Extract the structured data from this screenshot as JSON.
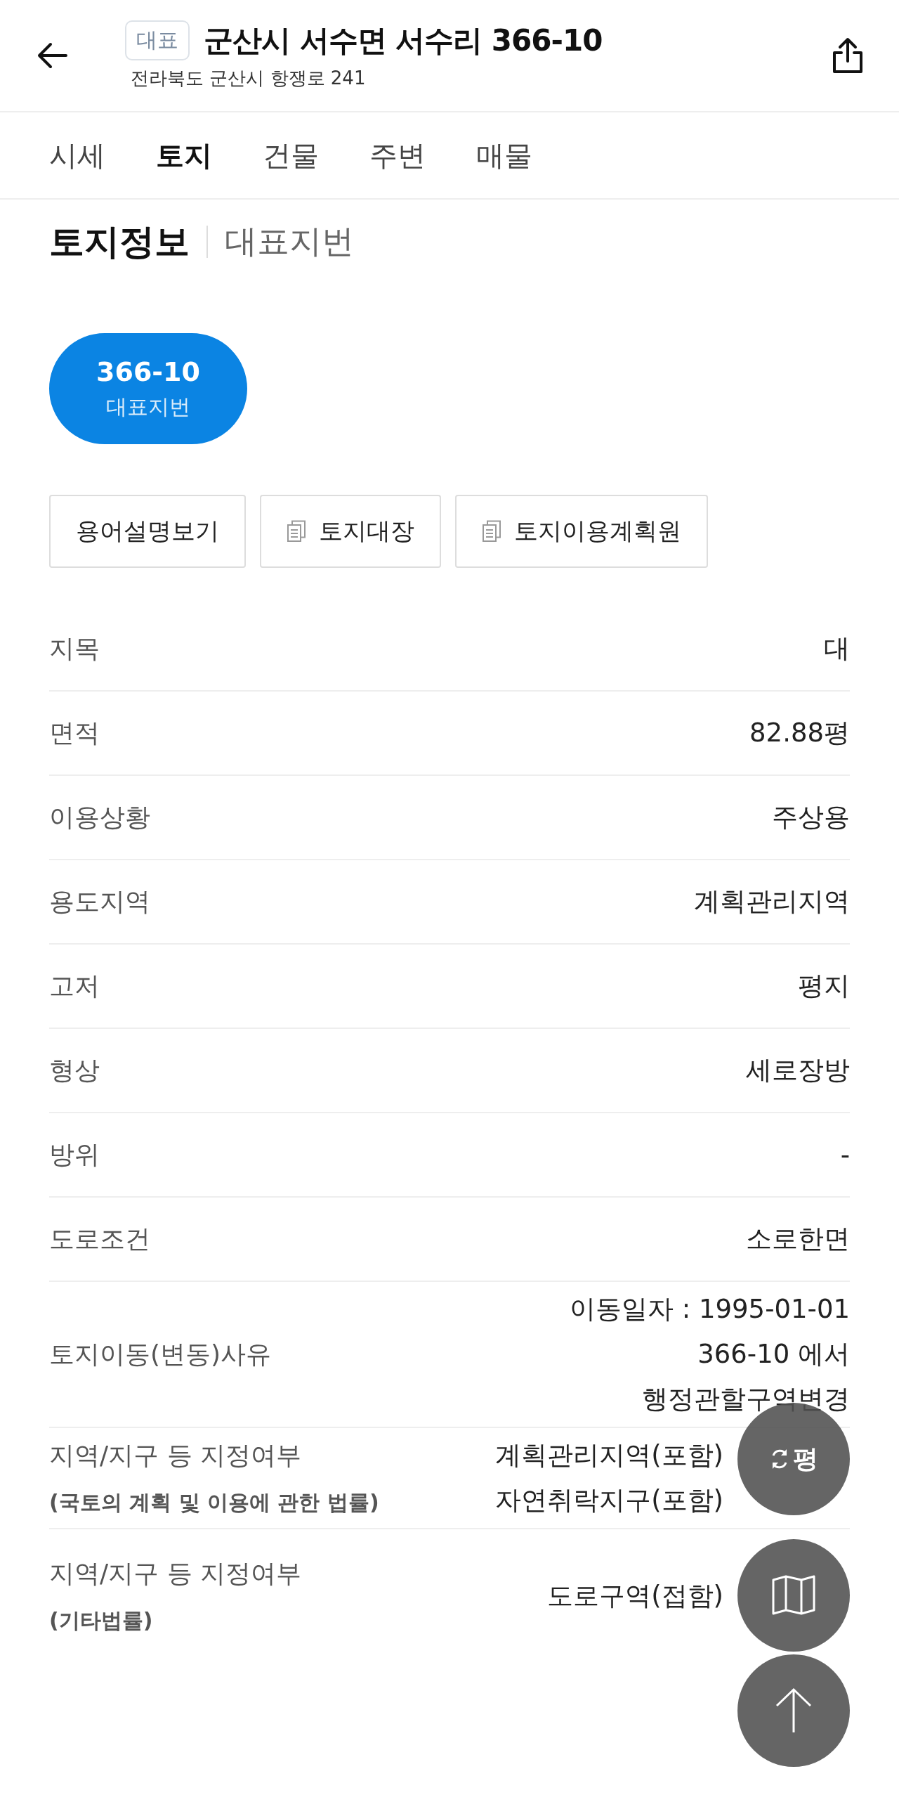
{
  "header": {
    "badge": "대표",
    "title": "군산시 서수면 서수리 366-10",
    "subtitle": "전라북도 군산시 항쟁로 241"
  },
  "tabs": [
    {
      "label": "시세",
      "selected": false
    },
    {
      "label": "토지",
      "selected": true
    },
    {
      "label": "건물",
      "selected": false
    },
    {
      "label": "주변",
      "selected": false
    },
    {
      "label": "매물",
      "selected": false
    }
  ],
  "section": {
    "title": "토지정보",
    "subtitle": "대표지번"
  },
  "lots": [
    {
      "number": "366-10",
      "label": "대표지번",
      "selected": true
    }
  ],
  "buttons": [
    {
      "kind": "plain",
      "label": "용어설명보기"
    },
    {
      "kind": "document",
      "label": "토지대장"
    },
    {
      "kind": "document",
      "label": "토지이용계획원"
    }
  ],
  "rows": [
    {
      "label": "지목",
      "values": [
        "대"
      ]
    },
    {
      "label": "면적",
      "values": [
        "82.88평"
      ]
    },
    {
      "label": "이용상황",
      "values": [
        "주상용"
      ]
    },
    {
      "label": "용도지역",
      "values": [
        "계획관리지역"
      ]
    },
    {
      "label": "고저",
      "values": [
        "평지"
      ]
    },
    {
      "label": "형상",
      "values": [
        "세로장방"
      ]
    },
    {
      "label": "방위",
      "values": [
        "-"
      ]
    },
    {
      "label": "도로조건",
      "values": [
        "소로한면"
      ]
    },
    {
      "label": "토지이동(변동)사유",
      "values": [
        "이동일자 : 1995-01-01",
        "366-10 에서",
        "행정관할구역변경"
      ]
    },
    {
      "label": "지역/지구 등 지정여부",
      "sublabel": "(국토의 계획 및 이용에 관한 법률)",
      "values": [
        "계획관리지역(포함)",
        "자연취락지구(포함)"
      ]
    },
    {
      "label": "지역/지구 등 지정여부",
      "sublabel": "(기타법률)",
      "values": [
        "도로구역(접함)"
      ]
    }
  ],
  "floating_buttons": [
    {
      "kind": "unit",
      "label": "평"
    },
    {
      "kind": "map"
    },
    {
      "kind": "top"
    }
  ]
}
